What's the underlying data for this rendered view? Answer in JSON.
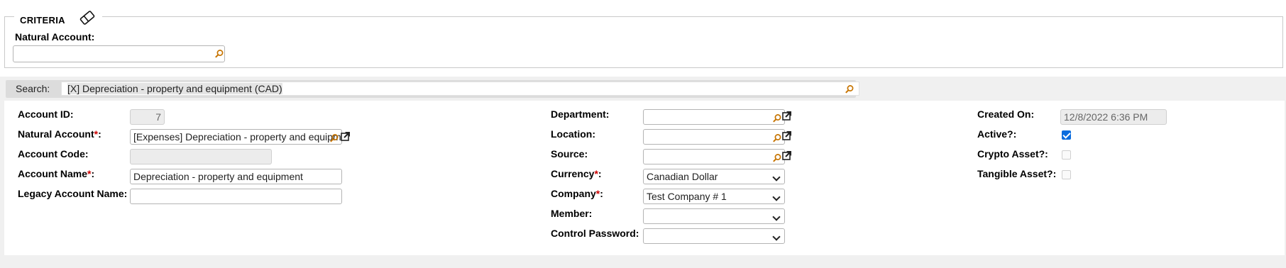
{
  "criteria": {
    "legend": "CRITERIA",
    "natural_account_label": "Natural Account:",
    "natural_account_value": ""
  },
  "search": {
    "label": "Search:",
    "value": "[X] Depreciation - property and equipment (CAD)"
  },
  "left_fields": {
    "account_id_label": "Account ID:",
    "account_id_value": "7",
    "natural_account_label": "Natural Account",
    "natural_account_value": "[Expenses] Depreciation - property and equipment",
    "account_code_label": "Account Code:",
    "account_code_value": "",
    "account_name_label": "Account Name",
    "account_name_value": "Depreciation - property and equipment",
    "legacy_account_name_label": "Legacy Account Name:",
    "legacy_account_name_value": ""
  },
  "middle_fields": {
    "department_label": "Department:",
    "location_label": "Location:",
    "source_label": "Source:",
    "currency_label": "Currency",
    "currency_value": "Canadian Dollar",
    "company_label": "Company",
    "company_value": "Test Company # 1",
    "member_label": "Member:",
    "member_value": "",
    "control_password_label": "Control Password:",
    "control_password_value": ""
  },
  "right_fields": {
    "created_on_label": "Created On:",
    "created_on_value": "12/8/2022 6:36 PM",
    "active_label": "Active?:",
    "active_checked": true,
    "crypto_asset_label": "Crypto Asset?:",
    "crypto_asset_checked": false,
    "tangible_asset_label": "Tangible Asset?:",
    "tangible_asset_checked": false
  },
  "common": {
    "required_marker": "*",
    "colon": ":"
  },
  "colors": {
    "required": "#cc0000",
    "checkbox_on": "#0a6cde",
    "lookup_icon": "#c77400"
  }
}
